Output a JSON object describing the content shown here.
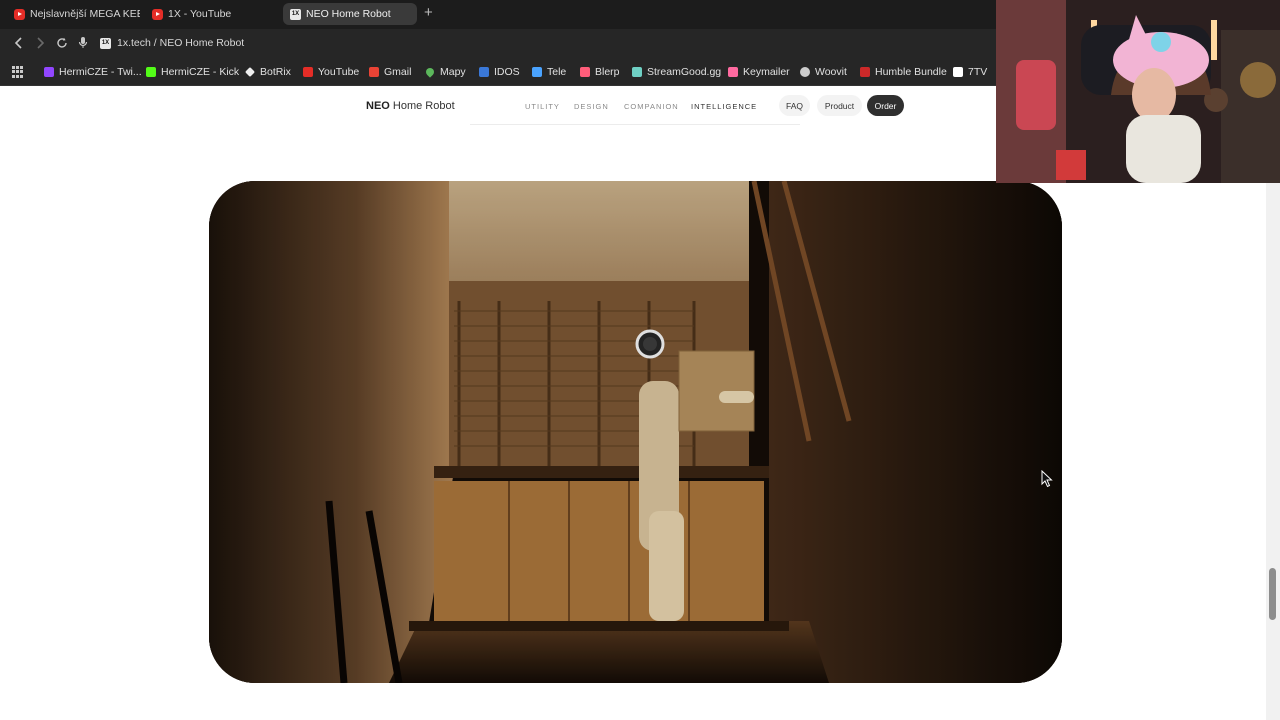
{
  "browser": {
    "tabs": [
      {
        "title": "Nejslavnější MEGA KEBAB",
        "favicon": "youtube-icon"
      },
      {
        "title": "1X - YouTube",
        "favicon": "youtube-icon"
      },
      {
        "title": "NEO Home Robot",
        "favicon": "1x-icon",
        "active": true
      }
    ],
    "new_tab": "+",
    "url": "1x.tech / NEO Home Robot",
    "bookmarks": [
      {
        "label": "HermiCZE - Twi...",
        "icon": "twitch-icon",
        "color": "#9146ff"
      },
      {
        "label": "HermiCZE - Kick",
        "icon": "kick-icon",
        "color": "#53fc18"
      },
      {
        "label": "BotRix",
        "icon": "botrix-icon",
        "color": "#ffffff"
      },
      {
        "label": "YouTube",
        "icon": "youtube-icon",
        "color": "#e52d27"
      },
      {
        "label": "Gmail",
        "icon": "gmail-icon",
        "color": "#ea4335"
      },
      {
        "label": "Mapy",
        "icon": "map-pin-icon",
        "color": "#5cb85c"
      },
      {
        "label": "IDOS",
        "icon": "idos-icon",
        "color": "#3a78d8"
      },
      {
        "label": "Tele",
        "icon": "tele-icon",
        "color": "#4aa3ff"
      },
      {
        "label": "Blerp",
        "icon": "blerp-icon",
        "color": "#ff5d7a"
      },
      {
        "label": "StreamGood.gg",
        "icon": "streamgood-icon",
        "color": "#6fd0c4"
      },
      {
        "label": "Keymailer",
        "icon": "keymailer-icon",
        "color": "#ff6aa0"
      },
      {
        "label": "Woovit",
        "icon": "woovit-icon",
        "color": "#cccccc"
      },
      {
        "label": "Humble Bundle",
        "icon": "humble-icon",
        "color": "#cc2929"
      },
      {
        "label": "7TV",
        "icon": "7tv-icon",
        "color": "#ffffff"
      }
    ]
  },
  "site": {
    "logo_bold": "NEO",
    "logo_rest": " Home Robot",
    "nav": [
      {
        "label": "UTILITY",
        "active": false
      },
      {
        "label": "DESIGN",
        "active": false
      },
      {
        "label": "COMPANION",
        "active": false
      },
      {
        "label": "INTELLIGENCE",
        "active": true
      }
    ],
    "faq": "FAQ",
    "product": "Product",
    "order": "Order"
  },
  "colors": {
    "browser_bg": "#1f1f1f",
    "accent_button": "#2f2f2f",
    "page_bg": "#ffffff"
  }
}
